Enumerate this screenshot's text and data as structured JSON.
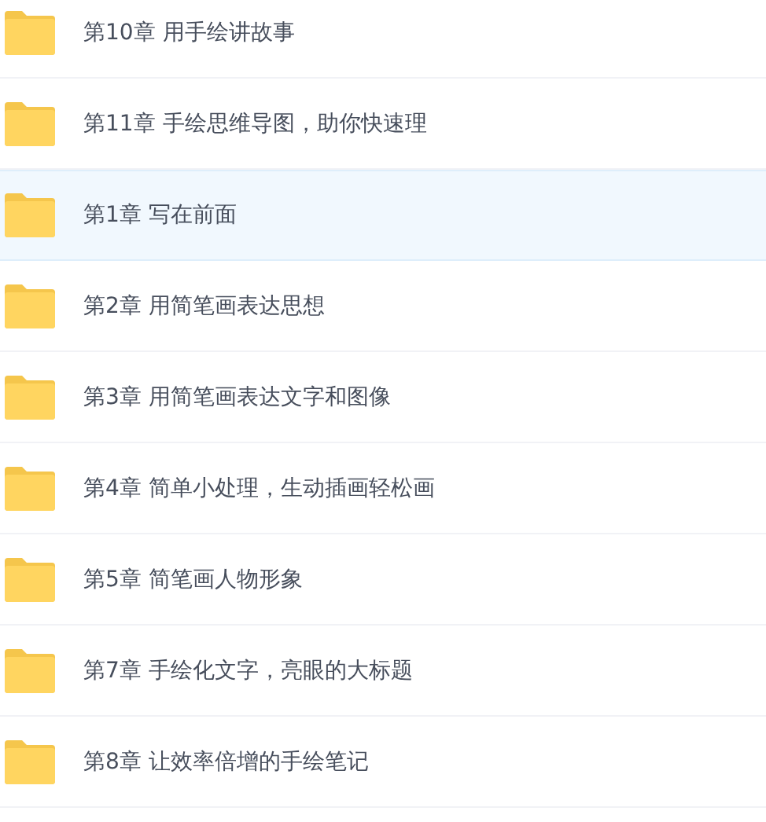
{
  "files": [
    {
      "name": "第10章 用手绘讲故事",
      "selected": false
    },
    {
      "name": "第11章 手绘思维导图，助你快速理",
      "selected": false
    },
    {
      "name": "第1章 写在前面",
      "selected": true
    },
    {
      "name": "第2章 用简笔画表达思想",
      "selected": false
    },
    {
      "name": "第3章 用简笔画表达文字和图像",
      "selected": false
    },
    {
      "name": "第4章 简单小处理，生动插画轻松画",
      "selected": false
    },
    {
      "name": "第5章 简笔画人物形象",
      "selected": false
    },
    {
      "name": "第7章 手绘化文字，亮眼的大标题",
      "selected": false
    },
    {
      "name": "第8章 让效率倍增的手绘笔记",
      "selected": false
    }
  ]
}
